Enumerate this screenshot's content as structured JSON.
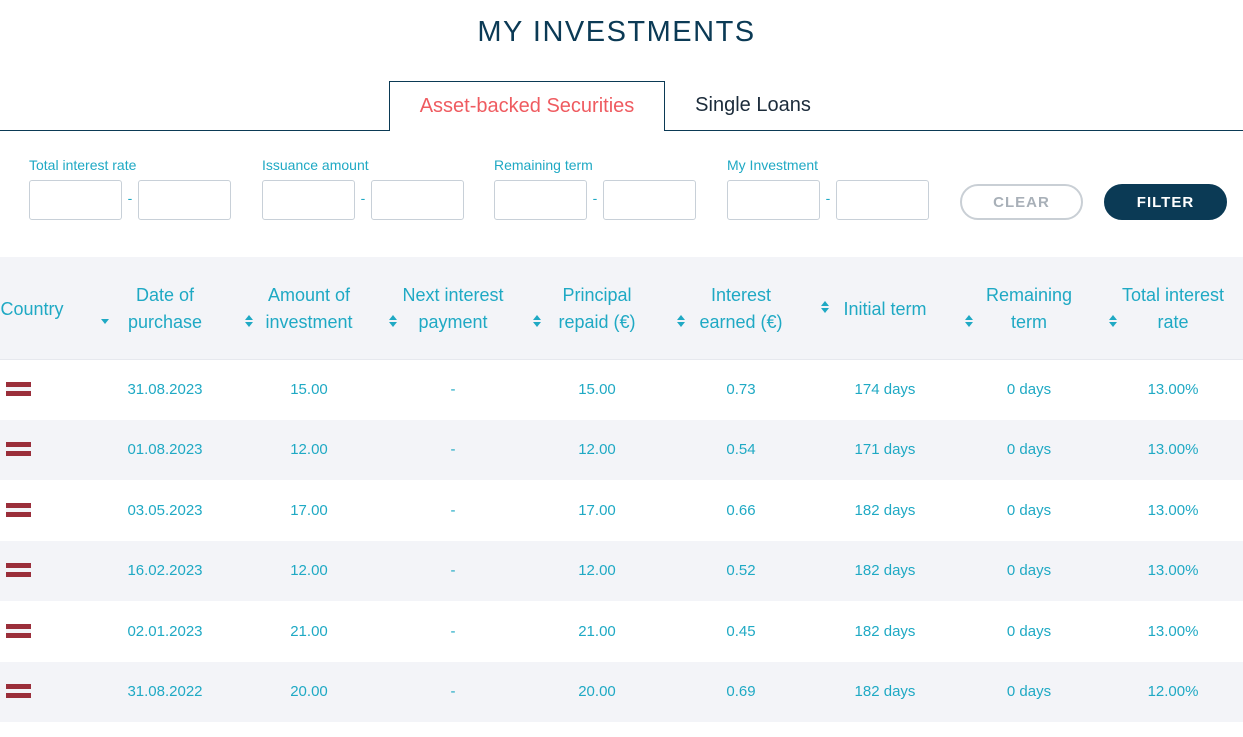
{
  "page_title": "MY INVESTMENTS",
  "tabs": [
    {
      "label": "Asset-backed Securities",
      "active": true
    },
    {
      "label": "Single Loans",
      "active": false
    }
  ],
  "filters": [
    {
      "label": "Total interest rate",
      "from": "",
      "to": "",
      "separator": "-"
    },
    {
      "label": "Issuance amount",
      "from": "",
      "to": "",
      "separator": "-"
    },
    {
      "label": "Remaining term",
      "from": "",
      "to": "",
      "separator": "-"
    },
    {
      "label": "My Investment",
      "from": "",
      "to": "",
      "separator": "-"
    }
  ],
  "buttons": {
    "clear": "CLEAR",
    "filter": "FILTER"
  },
  "columns": [
    {
      "label": "Country",
      "sort": "none"
    },
    {
      "label": "Date of purchase",
      "sort": "desc"
    },
    {
      "label": "Amount of investment",
      "sort": "both"
    },
    {
      "label": "Next interest payment",
      "sort": "both"
    },
    {
      "label": "Principal repaid (€)",
      "sort": "both"
    },
    {
      "label": "Interest earned (€)",
      "sort": "both"
    },
    {
      "label": "Initial term",
      "sort": "both"
    },
    {
      "label": "Remaining term",
      "sort": "both"
    },
    {
      "label": "Total interest rate",
      "sort": "both"
    }
  ],
  "rows": [
    {
      "country_icon": "latvia-flag-icon",
      "date": "31.08.2023",
      "amount": "15.00",
      "next_payment": "-",
      "principal": "15.00",
      "interest": "0.73",
      "initial_term": "174 days",
      "remaining_term": "0 days",
      "rate": "13.00%"
    },
    {
      "country_icon": "latvia-flag-icon",
      "date": "01.08.2023",
      "amount": "12.00",
      "next_payment": "-",
      "principal": "12.00",
      "interest": "0.54",
      "initial_term": "171 days",
      "remaining_term": "0 days",
      "rate": "13.00%"
    },
    {
      "country_icon": "latvia-flag-icon",
      "date": "03.05.2023",
      "amount": "17.00",
      "next_payment": "-",
      "principal": "17.00",
      "interest": "0.66",
      "initial_term": "182 days",
      "remaining_term": "0 days",
      "rate": "13.00%"
    },
    {
      "country_icon": "latvia-flag-icon",
      "date": "16.02.2023",
      "amount": "12.00",
      "next_payment": "-",
      "principal": "12.00",
      "interest": "0.52",
      "initial_term": "182 days",
      "remaining_term": "0 days",
      "rate": "13.00%"
    },
    {
      "country_icon": "latvia-flag-icon",
      "date": "02.01.2023",
      "amount": "21.00",
      "next_payment": "-",
      "principal": "21.00",
      "interest": "0.45",
      "initial_term": "182 days",
      "remaining_term": "0 days",
      "rate": "13.00%"
    },
    {
      "country_icon": "latvia-flag-icon",
      "date": "31.08.2022",
      "amount": "20.00",
      "next_payment": "-",
      "principal": "20.00",
      "interest": "0.69",
      "initial_term": "182 days",
      "remaining_term": "0 days",
      "rate": "12.00%"
    }
  ],
  "colors": {
    "accent": "#1fa9c4",
    "navy": "#0b3a55",
    "active_tab": "#ef5b60",
    "flag_red": "#9a2e3a"
  }
}
